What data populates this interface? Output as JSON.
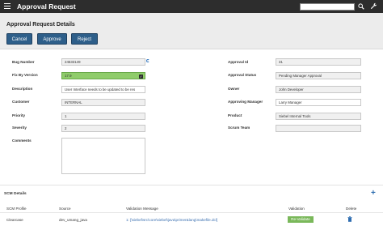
{
  "app": {
    "title": "Approval Request",
    "search_placeholder": ""
  },
  "header": {
    "title": "Approval Request Details",
    "buttons": {
      "cancel": "Cancel",
      "approve": "Approve",
      "reject": "Reject"
    }
  },
  "form": {
    "bug_number": {
      "label": "Bug Number",
      "value": "24533149"
    },
    "fix_by_version": {
      "label": "Fix By Version",
      "value": "17.9"
    },
    "description": {
      "label": "Description",
      "value": "User Interface needs to be updated to be res"
    },
    "customer": {
      "label": "Customer",
      "value": "INTERNAL"
    },
    "priority": {
      "label": "Priority",
      "value": "1"
    },
    "severity": {
      "label": "Severity",
      "value": "2"
    },
    "comments": {
      "label": "Comments",
      "value": ""
    },
    "approval_id": {
      "label": "Approval Id",
      "value": "31"
    },
    "approval_status": {
      "label": "Approval Status",
      "value": "Pending Manager Approval"
    },
    "owner": {
      "label": "Owner",
      "value": "John Developer"
    },
    "approving_manager": {
      "label": "Approving Manager",
      "value": "Larry Manager"
    },
    "product": {
      "label": "Product",
      "value": "Siebel Internal Tools"
    },
    "scrum_team": {
      "label": "Scrum Team",
      "value": ""
    }
  },
  "scm": {
    "title": "SCM Details",
    "headers": [
      "SCM Profile",
      "Source",
      "Validation Message",
      "Validation",
      "Delete"
    ],
    "rows": [
      {
        "profile": "Clearcase",
        "source": "dev_umang_java",
        "message": "1: [\\siebel\\src\\core\\siebel\\java\\primer&lang\\makefile.dcl]",
        "validation": "Re-Validate"
      }
    ]
  },
  "colors": {
    "topbar": "#2d2d2d",
    "button": "#2e5f8a",
    "valid_green": "#8fcc6a",
    "link": "#3a6fb0"
  }
}
